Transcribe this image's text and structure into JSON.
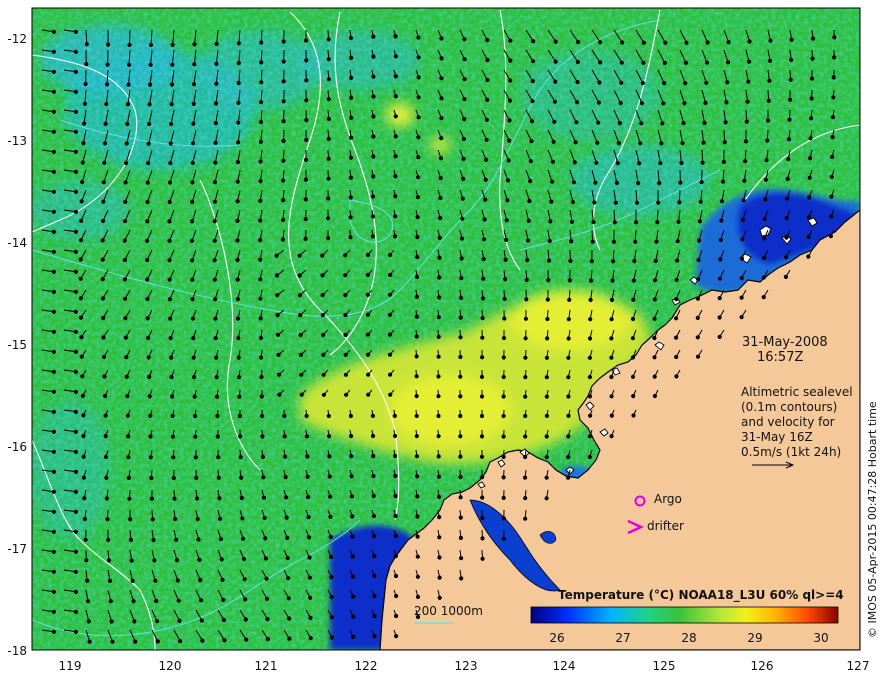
{
  "axes": {
    "lon_ticks": [
      "119",
      "120",
      "121",
      "122",
      "123",
      "124",
      "125",
      "126",
      "127"
    ],
    "lat_ticks": [
      "-12",
      "-13",
      "-14",
      "-15",
      "-16",
      "-17",
      "-18"
    ]
  },
  "annotation": {
    "date": "31-May-2008",
    "time": "16:57Z",
    "info_lines": [
      "Altimetric sealevel",
      "(0.1m contours)",
      "and velocity for",
      "31-May 16Z",
      "0.5m/s (1kt 24h)"
    ]
  },
  "legend": {
    "argo_label": "Argo",
    "drifter_label": "drifter",
    "marker_color": "#e000e0"
  },
  "bathymetry_label": "200  1000m",
  "colorbar": {
    "title": "Temperature (°C) NOAA18_L3U 60% ql>=4",
    "ticks": [
      "26",
      "27",
      "28",
      "29",
      "30"
    ]
  },
  "credit": "© IMOS 05-Apr-2015 00:47:28 Hobart time",
  "colors": {
    "ocean_green": "#2fbf3c",
    "ocean_cyan": "#29b6d6",
    "ocean_yellow": "#dfee3a",
    "cold_blue": "#0a2ec8",
    "land": "#f5c89a"
  }
}
